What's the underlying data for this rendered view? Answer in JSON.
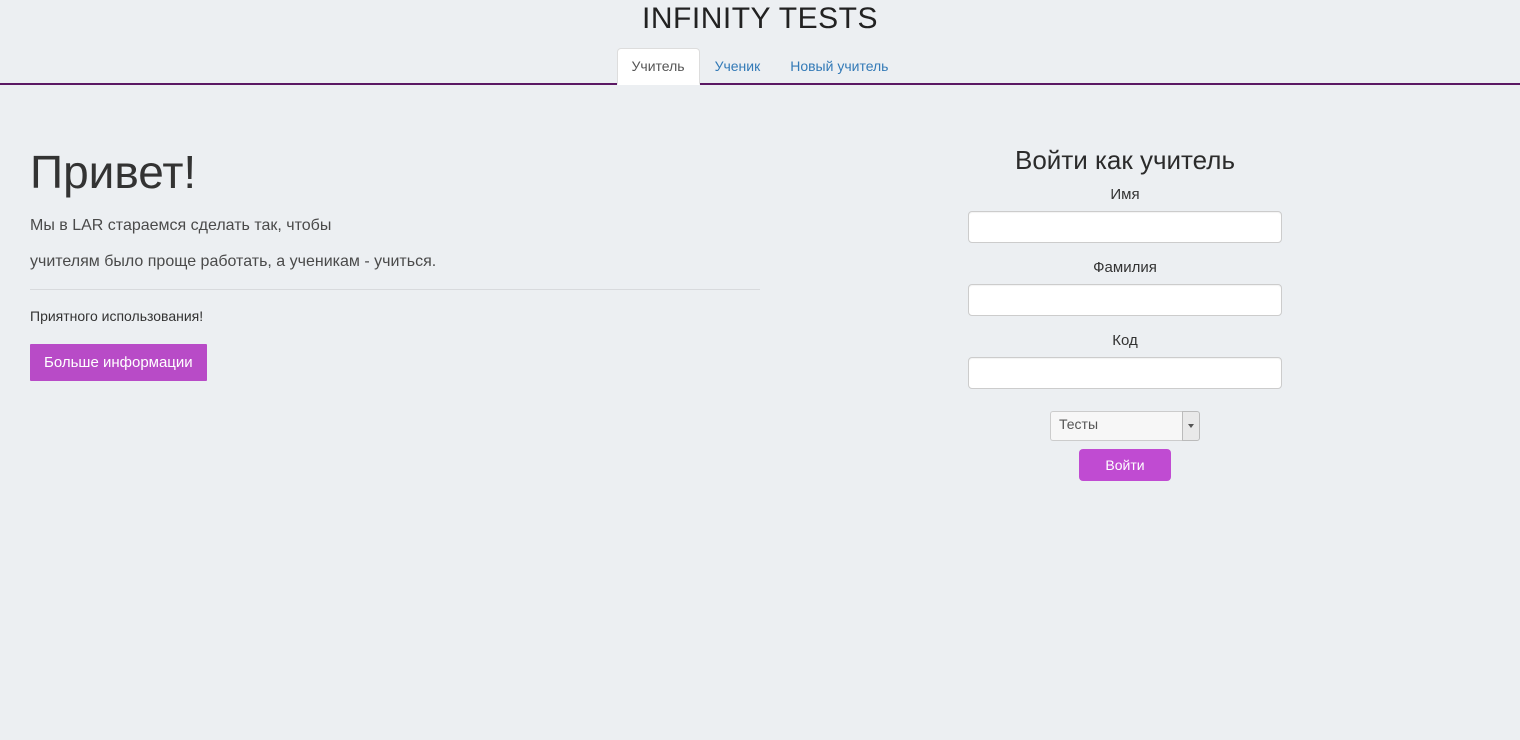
{
  "header": {
    "title": "INFINITY TESTS"
  },
  "tabs": [
    {
      "label": "Учитель",
      "active": true
    },
    {
      "label": "Ученик",
      "active": false
    },
    {
      "label": "Новый учитель",
      "active": false
    }
  ],
  "welcome": {
    "greeting": "Привет!",
    "line1": "Мы в LAR стараемся сделать так, чтобы",
    "line2": "учителям было проще работать, а ученикам - учиться.",
    "farewell": "Приятного использования!",
    "more_button": "Больше информации"
  },
  "login": {
    "title": "Войти как учитель",
    "labels": {
      "name": "Имя",
      "surname": "Фамилия",
      "code": "Код"
    },
    "values": {
      "name": "",
      "surname": "",
      "code": ""
    },
    "select": {
      "selected": "Тесты"
    },
    "submit": "Войти"
  },
  "colors": {
    "accent": "#b84bc7",
    "tab_border": "#5b1863",
    "link": "#337ab7"
  }
}
